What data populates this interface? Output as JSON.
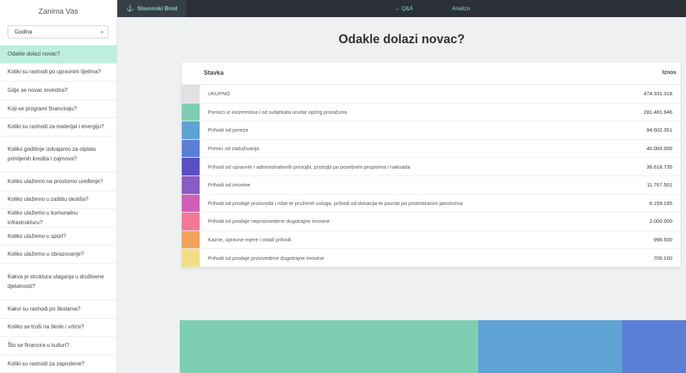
{
  "sidebar": {
    "title": "Zanima Vas",
    "select_value": "Godina",
    "select_icon": "chevrons-right-icon",
    "items": [
      {
        "label": "Odakle dolazi novac?",
        "active": true,
        "lines": 1
      },
      {
        "label": "Koliki su rashodi po upravnim tijelima?",
        "lines": 1
      },
      {
        "label": "Gdje se novac investira?",
        "lines": 1
      },
      {
        "label": "Koji se programi financiraju?",
        "lines": 1
      },
      {
        "label": "Koliki su rashodi za materijal i energiju?",
        "lines": 1
      },
      {
        "label": "Koliko godišnje izdvajamo za otplatu primljenih kredita i zajmova?",
        "lines": 2
      },
      {
        "label": "Koliko ulažemo na prostorno uređenje?",
        "lines": 1
      },
      {
        "label": "Koliko ulažemo u zaštitu okoliša?",
        "lines": 1
      },
      {
        "label": "Koliko ulažemo u komunalnu infrastrukturu?",
        "lines": 1
      },
      {
        "label": "Koliko ulažemo u sport?",
        "lines": 1
      },
      {
        "label": "Koliko ulažemo u obrazovanje?",
        "lines": 1
      },
      {
        "label": "Kakva je struktura ulaganja u društvene djelatnosti?",
        "lines": 2
      },
      {
        "label": "Kakvi su rashodi po školama?",
        "lines": 1
      },
      {
        "label": "Koliko se troši na škole i vrtiće?",
        "lines": 1
      },
      {
        "label": "Što se financira u kulturi?",
        "lines": 1
      },
      {
        "label": "Koliki su rashodi za zaposlene?",
        "lines": 1
      }
    ]
  },
  "topbar": {
    "city": "Slavonski Brod",
    "city_icon": "anchor-icon",
    "nav": [
      {
        "label": "→ Q&A"
      },
      {
        "label": "Analiza"
      }
    ]
  },
  "main": {
    "title": "Odakle dolazi novac?",
    "table": {
      "col_item": "Stavka",
      "col_amount": "Iznos",
      "rows": [
        {
          "label": "UKUPNO",
          "value": "474.331.318",
          "color": "#dfe1e4"
        },
        {
          "label": "Pomoći iz inozemstva i od subjekata unutar općeg proračuna",
          "value": "281.481.946",
          "color": "#7ecfb1"
        },
        {
          "label": "Prihodi od poreza",
          "value": "94.602.351",
          "color": "#5fa2d4"
        },
        {
          "label": "Primici od zaduživanja",
          "value": "40.000.000",
          "color": "#5b7fd6"
        },
        {
          "label": "Prihodi od upravnih i administrativnih pristojbi, pristojbi po posebnim propisima i naknada",
          "value": "36.618.735",
          "color": "#5a4fc6"
        },
        {
          "label": "Prihodi od imovine",
          "value": "11.767.501",
          "color": "#8a5bc4"
        },
        {
          "label": "Prihodi od prodaje proizvoda i robe te pruženih usluga, prihodi od donacija te povrati po protestiranim jamstvima",
          "value": "6.159.185",
          "color": "#cf5fb8"
        },
        {
          "label": "Prihodi od prodaje neproizvedene dugotrajne imovine",
          "value": "2.000.000",
          "color": "#f37896"
        },
        {
          "label": "Kazne, upravne mjere i ostali prihodi",
          "value": "996.500",
          "color": "#f2a25b"
        },
        {
          "label": "Prihodi od prodaje proizvedene dugotrajne imovine",
          "value": "705.100",
          "color": "#f1de86"
        }
      ]
    }
  },
  "treemap": {
    "blocks": [
      {
        "share": 0.5894,
        "color": "#7ecfb1"
      },
      {
        "share": 0.2847,
        "color": "#5fa2d4"
      },
      {
        "share": 0.1259,
        "color": "#5b7fd6"
      }
    ]
  }
}
